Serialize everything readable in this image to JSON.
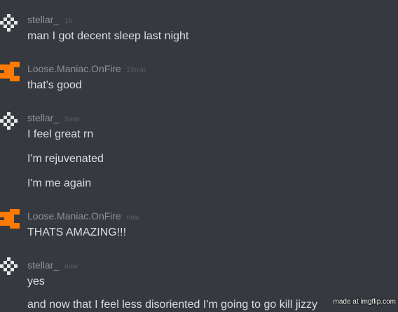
{
  "colors": {
    "background": "#36393f",
    "username": "#8e9297",
    "timestamp": "#5d6066",
    "message_text": "#dcddde",
    "stellar_avatar": "#e6e6e6",
    "loose_avatar": "#ff7a00"
  },
  "messages": [
    {
      "username": "stellar_",
      "time": "1h",
      "avatar_icon": "checkered-diamond-icon",
      "lines": [
        "man I got decent sleep last night"
      ]
    },
    {
      "username": "Loose.Maniac.OnFire",
      "time": "22min",
      "avatar_icon": "orange-bracket-icon",
      "lines": [
        "that's good"
      ]
    },
    {
      "username": "stellar_",
      "time": "5min",
      "avatar_icon": "checkered-diamond-icon",
      "lines": [
        "I feel great rn",
        "I'm rejuvenated",
        "I'm me again"
      ]
    },
    {
      "username": "Loose.Maniac.OnFire",
      "time": "now",
      "avatar_icon": "orange-bracket-icon",
      "lines": [
        "THATS AMAZING!!!"
      ]
    },
    {
      "username": "stellar_",
      "time": "now",
      "avatar_icon": "checkered-diamond-icon",
      "lines": [
        "yes",
        "and now that I feel less disoriented I'm going to go kill jizzy"
      ]
    }
  ],
  "watermark": "made at imgflip.com"
}
